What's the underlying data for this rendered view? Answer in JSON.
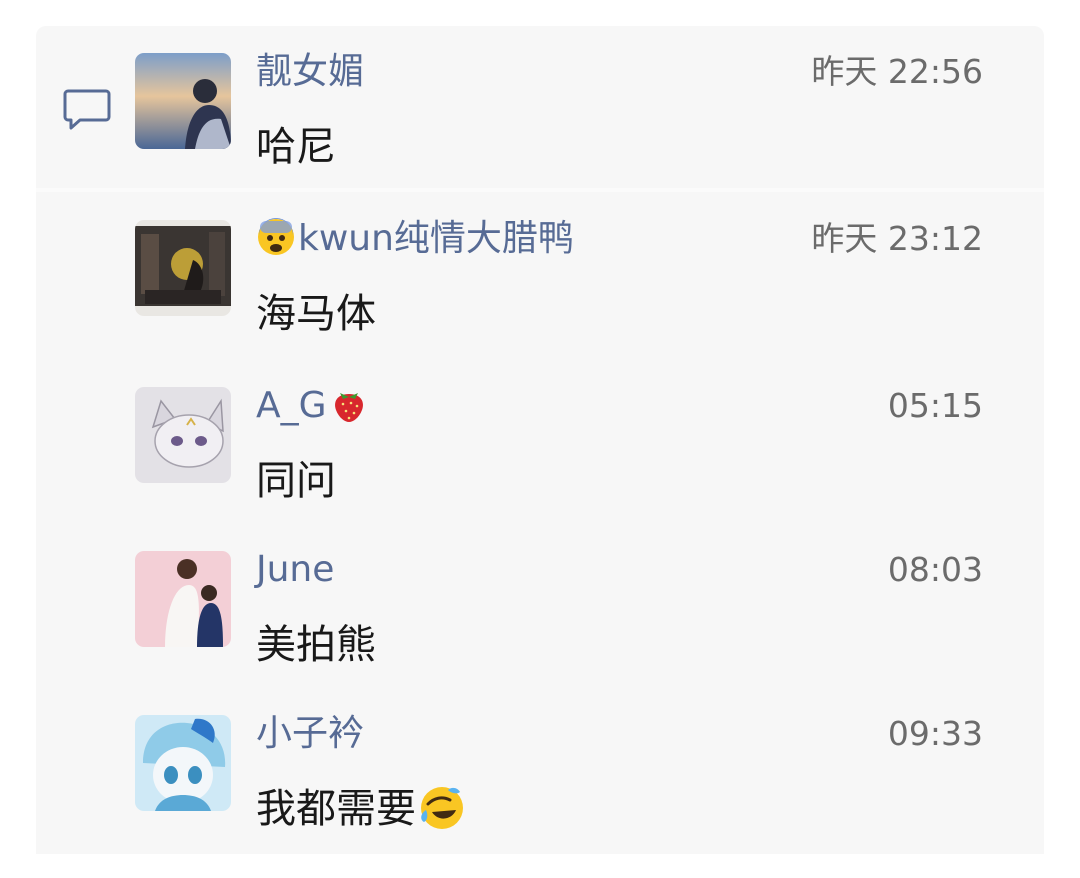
{
  "comments": [
    {
      "name": "靓女媚",
      "time": "昨天 22:56",
      "text": "哈尼"
    },
    {
      "name": "kwun纯情大腊鸭",
      "name_emoji": "fearful-face",
      "time": "昨天 23:12",
      "text": "海马体"
    },
    {
      "name": "A_G",
      "name_emoji": "strawberry",
      "time": "05:15",
      "text": "同问"
    },
    {
      "name": "June",
      "time": "08:03",
      "text": "美拍熊"
    },
    {
      "name": "小子衿",
      "time": "09:33",
      "text": "我都需要",
      "text_emoji": "rolling-on-floor-laughing"
    }
  ],
  "icons": {
    "section": "comment-bubble-icon"
  },
  "colors": {
    "name": "#576b95",
    "text": "#191919",
    "time": "#6b6b6b",
    "panel": "#f7f7f7"
  }
}
